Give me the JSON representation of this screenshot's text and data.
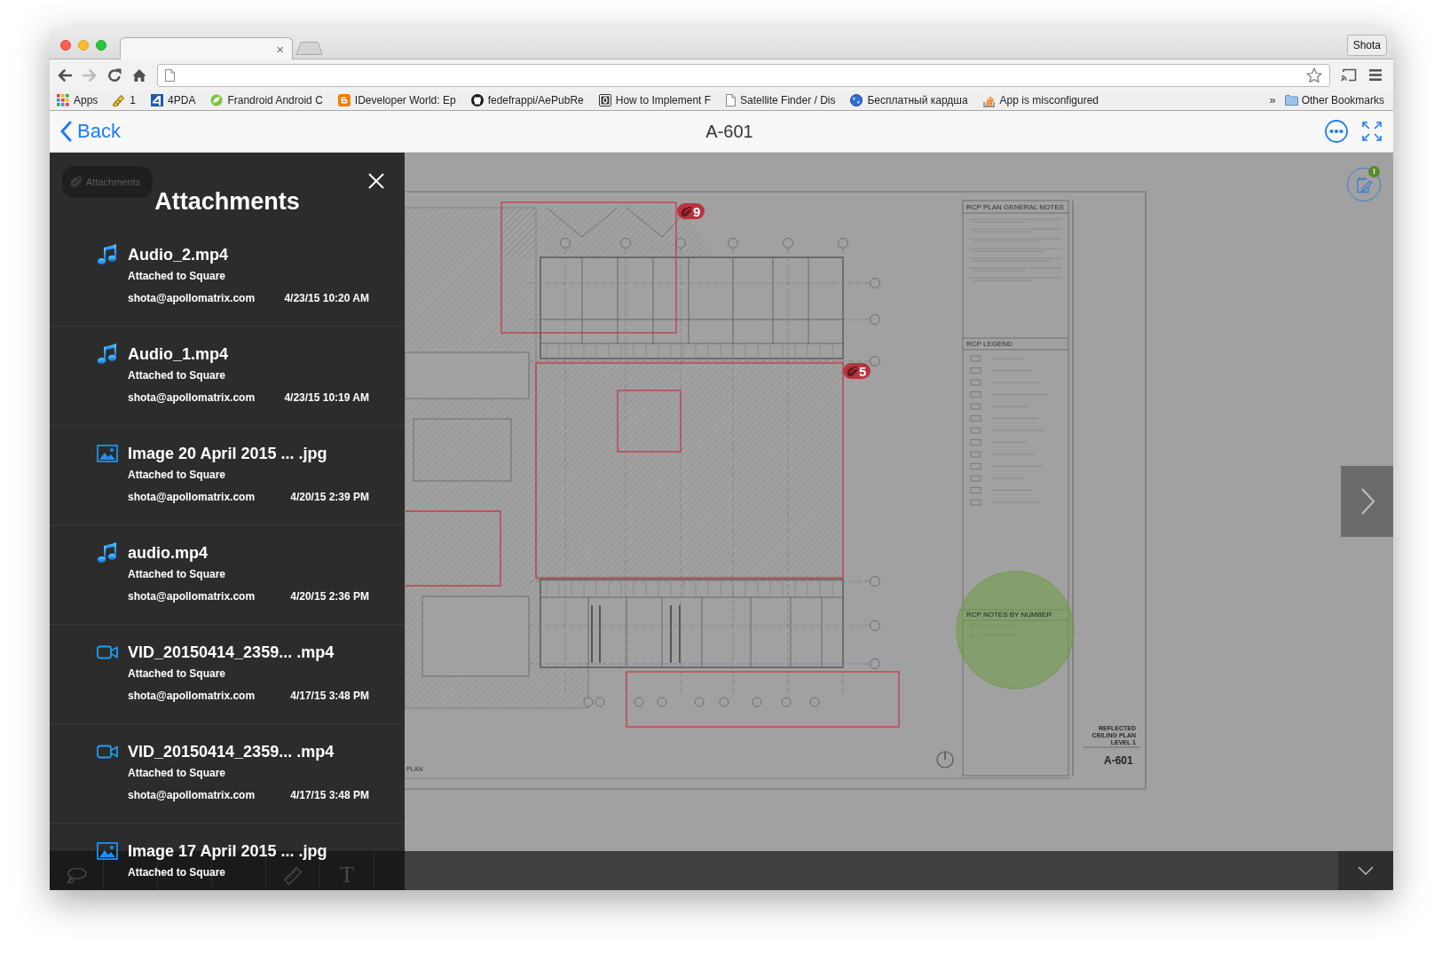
{
  "browser": {
    "tab": {
      "close": "×"
    },
    "profile": "Shota",
    "nav_buttons": [
      {
        "kind": "back",
        "disabled": false
      },
      {
        "kind": "forward",
        "disabled": true
      },
      {
        "kind": "reload",
        "disabled": false
      },
      {
        "kind": "home",
        "disabled": false
      }
    ],
    "bookmarks": [
      {
        "kind": "apps",
        "label": "Apps"
      },
      {
        "kind": "pencil",
        "label": "1"
      },
      {
        "kind": "tile",
        "label": "4PDA"
      },
      {
        "kind": "circle",
        "label": "Frandroid Android C"
      },
      {
        "kind": "blog",
        "label": "IDeveloper World: Ep"
      },
      {
        "kind": "cat",
        "label": "fedefrappi/AePubRe"
      },
      {
        "kind": "ring",
        "label": "How to Implement F"
      },
      {
        "kind": "page",
        "label": "Satellite Finder / Dis"
      },
      {
        "kind": "globe",
        "label": "Бесплатный кардша"
      },
      {
        "kind": "tray",
        "label": "App is misconfigured"
      }
    ],
    "more_bookmarks": "»",
    "other_bookmarks": "Other Bookmarks"
  },
  "header": {
    "back": "Back",
    "title": "A-601"
  },
  "attachments": {
    "tab_label": "Attachments",
    "title": "Attachments",
    "items": [
      {
        "kind": "audio",
        "name": "Audio_2.mp4",
        "attached_to": "Attached to Square",
        "user": "shota@apollomatrix.com",
        "date": "4/23/15 10:20 AM"
      },
      {
        "kind": "audio",
        "name": "Audio_1.mp4",
        "attached_to": "Attached to Square",
        "user": "shota@apollomatrix.com",
        "date": "4/23/15 10:19 AM"
      },
      {
        "kind": "image",
        "name": "Image 20 April 2015 ... .jpg",
        "attached_to": "Attached to Square",
        "user": "shota@apollomatrix.com",
        "date": "4/20/15 2:39 PM"
      },
      {
        "kind": "audio",
        "name": "audio.mp4",
        "attached_to": "Attached to Square",
        "user": "shota@apollomatrix.com",
        "date": "4/20/15 2:36 PM"
      },
      {
        "kind": "video",
        "name": "VID_20150414_2359... .mp4",
        "attached_to": "Attached to Square",
        "user": "shota@apollomatrix.com",
        "date": "4/17/15 3:48 PM"
      },
      {
        "kind": "video",
        "name": "VID_20150414_2359... .mp4",
        "attached_to": "Attached to Square",
        "user": "shota@apollomatrix.com",
        "date": "4/17/15 3:48 PM"
      },
      {
        "kind": "image",
        "name": "Image 17 April 2015 ... .jpg",
        "attached_to": "Attached to Square"
      }
    ]
  },
  "viewer": {
    "markup_badges": [
      {
        "count": "9"
      },
      {
        "count": "5"
      }
    ],
    "title_block": {
      "general_notes": "RCP PLAN GENERAL NOTES",
      "legend": "RCP LEGEND",
      "notes_by_number": "RCP NOTES BY NUMBER",
      "sheet_title": "REFLECTED CEILING PLAN LEVEL 1",
      "sheet_number": "A-601"
    },
    "view_label": "PLAN",
    "notes_badge": "!"
  },
  "toolbar": {
    "tools": [
      {
        "kind": "lasso"
      },
      {
        "kind": "ruler"
      },
      {
        "kind": "text",
        "glyph": "T"
      }
    ]
  }
}
